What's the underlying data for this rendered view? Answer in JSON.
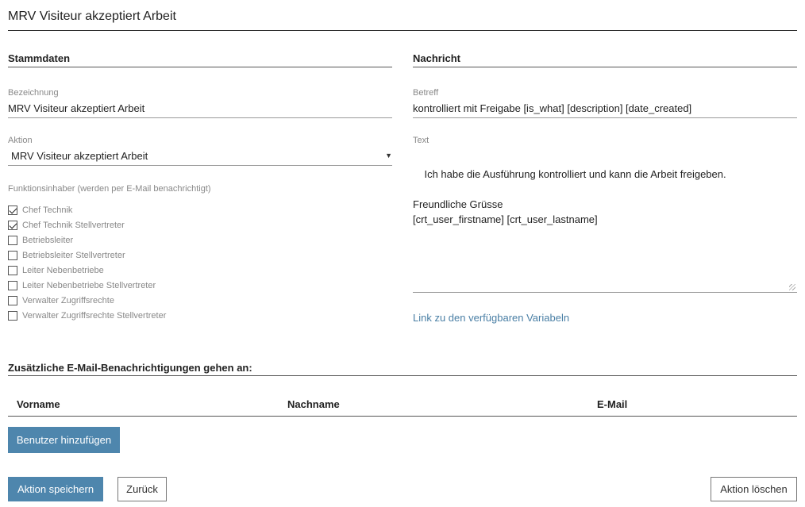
{
  "page": {
    "title": "MRV Visiteur akzeptiert Arbeit"
  },
  "stammdaten": {
    "heading": "Stammdaten",
    "bezeichnung_label": "Bezeichnung",
    "bezeichnung_value": "MRV Visiteur akzeptiert Arbeit",
    "aktion_label": "Aktion",
    "aktion_value": "MRV Visiteur akzeptiert Arbeit",
    "funktion_label": "Funktionsinhaber (werden per E-Mail benachrichtigt)",
    "funktionen": [
      {
        "label": "Chef Technik",
        "checked": true
      },
      {
        "label": "Chef Technik Stellvertreter",
        "checked": true
      },
      {
        "label": "Betriebsleiter",
        "checked": false
      },
      {
        "label": "Betriebsleiter Stellvertreter",
        "checked": false
      },
      {
        "label": "Leiter Nebenbetriebe",
        "checked": false
      },
      {
        "label": "Leiter Nebenbetriebe Stellvertreter",
        "checked": false
      },
      {
        "label": "Verwalter Zugriffsrechte",
        "checked": false
      },
      {
        "label": "Verwalter Zugriffsrechte Stellvertreter",
        "checked": false
      }
    ]
  },
  "nachricht": {
    "heading": "Nachricht",
    "betreff_label": "Betreff",
    "betreff_value": "kontrolliert mit Freigabe [is_what] [description] [date_created]",
    "text_label": "Text",
    "text_value": "Ich habe die Ausführung kontrolliert und kann die Arbeit freigeben.\n\nFreundliche Grüsse\n[crt_user_firstname] [crt_user_lastname]",
    "variables_link": "Link zu den verfügbaren Variabeln"
  },
  "extra_notifications": {
    "heading": "Zusätzliche E-Mail-Benachrichtigungen gehen an:",
    "columns": {
      "vorname": "Vorname",
      "nachname": "Nachname",
      "email": "E-Mail"
    },
    "add_button": "Benutzer hinzufügen"
  },
  "actions": {
    "save": "Aktion speichern",
    "back": "Zurück",
    "delete": "Aktion löschen"
  },
  "colors": {
    "primary": "#4e86ad",
    "link": "#4a7fa5"
  },
  "icons": {
    "select_caret": "caret-down-icon",
    "checkbox": "checkbox-icon",
    "resize": "resize-handle-icon"
  }
}
